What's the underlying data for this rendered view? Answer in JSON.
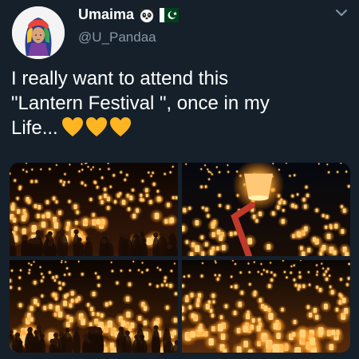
{
  "user": {
    "display_name": "Umaima",
    "handle": "@U_Pandaa",
    "name_emojis": [
      "panda-face-icon",
      "pakistan-flag-icon"
    ]
  },
  "tweet": {
    "text_lines": [
      "I really want to attend this",
      "\"Lantern Festival \", once in my",
      "Life..."
    ],
    "trailing_emojis": [
      "yellow-heart-icon",
      "yellow-heart-icon",
      "yellow-heart-icon"
    ]
  },
  "menu": {
    "icon": "chevron-down-icon"
  },
  "colors": {
    "background": "#15202b",
    "text_primary": "#ffffff",
    "text_secondary": "#8899a6",
    "heart": "#ffb521"
  }
}
